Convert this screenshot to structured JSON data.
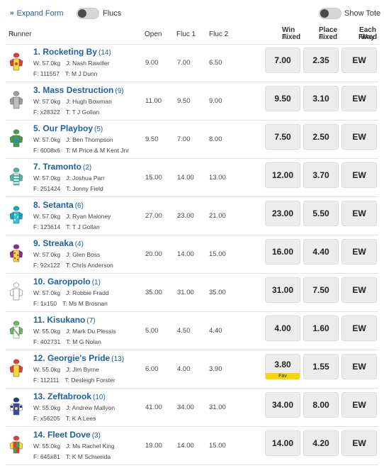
{
  "toolbar": {
    "expand_label": "Expand Form",
    "flucs_label": "Flucs",
    "show_tote_label": "Show Tote"
  },
  "headers": {
    "runner": "Runner",
    "open": "Open",
    "fluc1": "Fluc 1",
    "fluc2": "Fluc 2",
    "win_fixed_1": "Win",
    "win_fixed_2": "Fixed",
    "place_fixed_1": "Place",
    "place_fixed_2": "Fixed",
    "each_way_1": "Each Way",
    "each_way_2": "Fixed"
  },
  "runners": [
    {
      "number_name": "1. Rocketing By",
      "barrier": "(14)",
      "weight": "W: 57.0kg",
      "jockey": "J: Nash Rawiller",
      "form": "F: 111557",
      "trainer": "T: M J Dunn",
      "open": "9.00",
      "fluc1": "7.00",
      "fluc2": "6.50",
      "win": "7.00",
      "place": "2.35",
      "ew": "EW",
      "fav": "",
      "silk": {
        "cap": "#e53935",
        "body": "#fdd835",
        "sleeve": "#e53935",
        "pattern": "dot"
      }
    },
    {
      "number_name": "3. Mass Destruction",
      "barrier": "(9)",
      "weight": "W: 57.0kg",
      "jockey": "J: Hugh Bowman",
      "form": "F: x28322",
      "trainer": "T: T J Gollan",
      "open": "11.00",
      "fluc1": "9.50",
      "fluc2": "9.00",
      "win": "9.50",
      "place": "3.10",
      "ew": "EW",
      "fav": "",
      "silk": {
        "cap": "#9e9e9e",
        "body": "#bdbdbd",
        "sleeve": "#9e9e9e",
        "pattern": "plain"
      }
    },
    {
      "number_name": "5. Our Playboy",
      "barrier": "(5)",
      "weight": "W: 57.0kg",
      "jockey": "J: Ben Thompson",
      "form": "F: 6008x6",
      "trainer": "T: M Price & M Kent Jnr",
      "open": "9.50",
      "fluc1": "7.00",
      "fluc2": "8.00",
      "win": "7.50",
      "place": "2.50",
      "ew": "EW",
      "fav": "",
      "silk": {
        "cap": "#43a047",
        "body": "#43a047",
        "sleeve": "#43a047",
        "pattern": "diamond"
      }
    },
    {
      "number_name": "7. Tramonto",
      "barrier": "(2)",
      "weight": "W: 57.0kg",
      "jockey": "J: Joshua Parr",
      "form": "F: 251424",
      "trainer": "T: Jonny Field",
      "open": "15.00",
      "fluc1": "14.00",
      "fluc2": "13.00",
      "win": "12.00",
      "place": "3.70",
      "ew": "EW",
      "fav": "",
      "silk": {
        "cap": "#4db6ac",
        "body": "#e0f2f1",
        "sleeve": "#4db6ac",
        "pattern": "hoops"
      }
    },
    {
      "number_name": "8. Setanta",
      "barrier": "(6)",
      "weight": "W: 57.0kg",
      "jockey": "J: Ryan Maloney",
      "form": "F: 123614",
      "trainer": "T: T J Gollan",
      "open": "27.00",
      "fluc1": "23.00",
      "fluc2": "21.00",
      "win": "23.00",
      "place": "5.50",
      "ew": "EW",
      "fav": "",
      "silk": {
        "cap": "#00acc1",
        "body": "#26c6da",
        "sleeve": "#00acc1",
        "pattern": "spots"
      }
    },
    {
      "number_name": "9. Streaka",
      "barrier": "(4)",
      "weight": "W: 57.0kg",
      "jockey": "J: Glen Boss",
      "form": "F: 92x122",
      "trainer": "T: Chris Anderson",
      "open": "20.00",
      "fluc1": "14.00",
      "fluc2": "15.00",
      "win": "16.00",
      "place": "4.40",
      "ew": "EW",
      "fav": "",
      "silk": {
        "cap": "#8e24aa",
        "body": "#fdd835",
        "sleeve": "#8e24aa",
        "pattern": "spots-red"
      }
    },
    {
      "number_name": "10. Garoppolo",
      "barrier": "(1)",
      "weight": "W: 57.0kg",
      "jockey": "J: Robbie Fradd",
      "form": "F: 1x150",
      "trainer": "T: Ms M Brosnan",
      "open": "35.00",
      "fluc1": "31.00",
      "fluc2": "35.00",
      "win": "31.00",
      "place": "7.50",
      "ew": "EW",
      "fav": "",
      "silk": {
        "cap": "#ffffff",
        "body": "#ffffff",
        "sleeve": "#ffffff",
        "pattern": "outline"
      }
    },
    {
      "number_name": "11. Kisukano",
      "barrier": "(7)",
      "weight": "W: 55.0kg",
      "jockey": "J: Mark Du Plessis",
      "form": "F: 402731",
      "trainer": "T: M G Nolan",
      "open": "5.00",
      "fluc1": "4.50",
      "fluc2": "4.40",
      "win": "4.00",
      "place": "1.60",
      "ew": "EW",
      "fav": "",
      "silk": {
        "cap": "#66bb6a",
        "body": "#ffffff",
        "sleeve": "#66bb6a",
        "pattern": "sash"
      }
    },
    {
      "number_name": "12. Georgie's Pride",
      "barrier": "(13)",
      "weight": "W: 55.0kg",
      "jockey": "J: Jim Byrne",
      "form": "F: 112111",
      "trainer": "T: Desleigh Forster",
      "open": "6.00",
      "fluc1": "4.00",
      "fluc2": "3.90",
      "win": "3.80",
      "place": "1.55",
      "ew": "EW",
      "fav": "Fav",
      "silk": {
        "cap": "#e53935",
        "body": "#fdd835",
        "sleeve": "#e53935",
        "pattern": "plain"
      }
    },
    {
      "number_name": "13. Zeftabrook",
      "barrier": "(10)",
      "weight": "W: 55.0kg",
      "jockey": "J: Andrew Mallyon",
      "form": "F: x56205",
      "trainer": "T: K A Lees",
      "open": "41.00",
      "fluc1": "34.00",
      "fluc2": "31.00",
      "win": "34.00",
      "place": "8.00",
      "ew": "EW",
      "fav": "",
      "silk": {
        "cap": "#1e3a8a",
        "body": "#3949ab",
        "sleeve": "#ffffff",
        "pattern": "check-sleeve"
      }
    },
    {
      "number_name": "14. Fleet Dove",
      "barrier": "(3)",
      "weight": "W: 55.0kg",
      "jockey": "J: Ms Rachel King",
      "form": "F: 645x81",
      "trainer": "T: K M Schweida",
      "open": "19.00",
      "fluc1": "14.00",
      "fluc2": "15.00",
      "win": "14.00",
      "place": "4.20",
      "ew": "EW",
      "fav": "",
      "silk": {
        "cap": "#e53935",
        "body": "#43a047",
        "sleeve": "#fdd835",
        "pattern": "quarters"
      }
    }
  ]
}
